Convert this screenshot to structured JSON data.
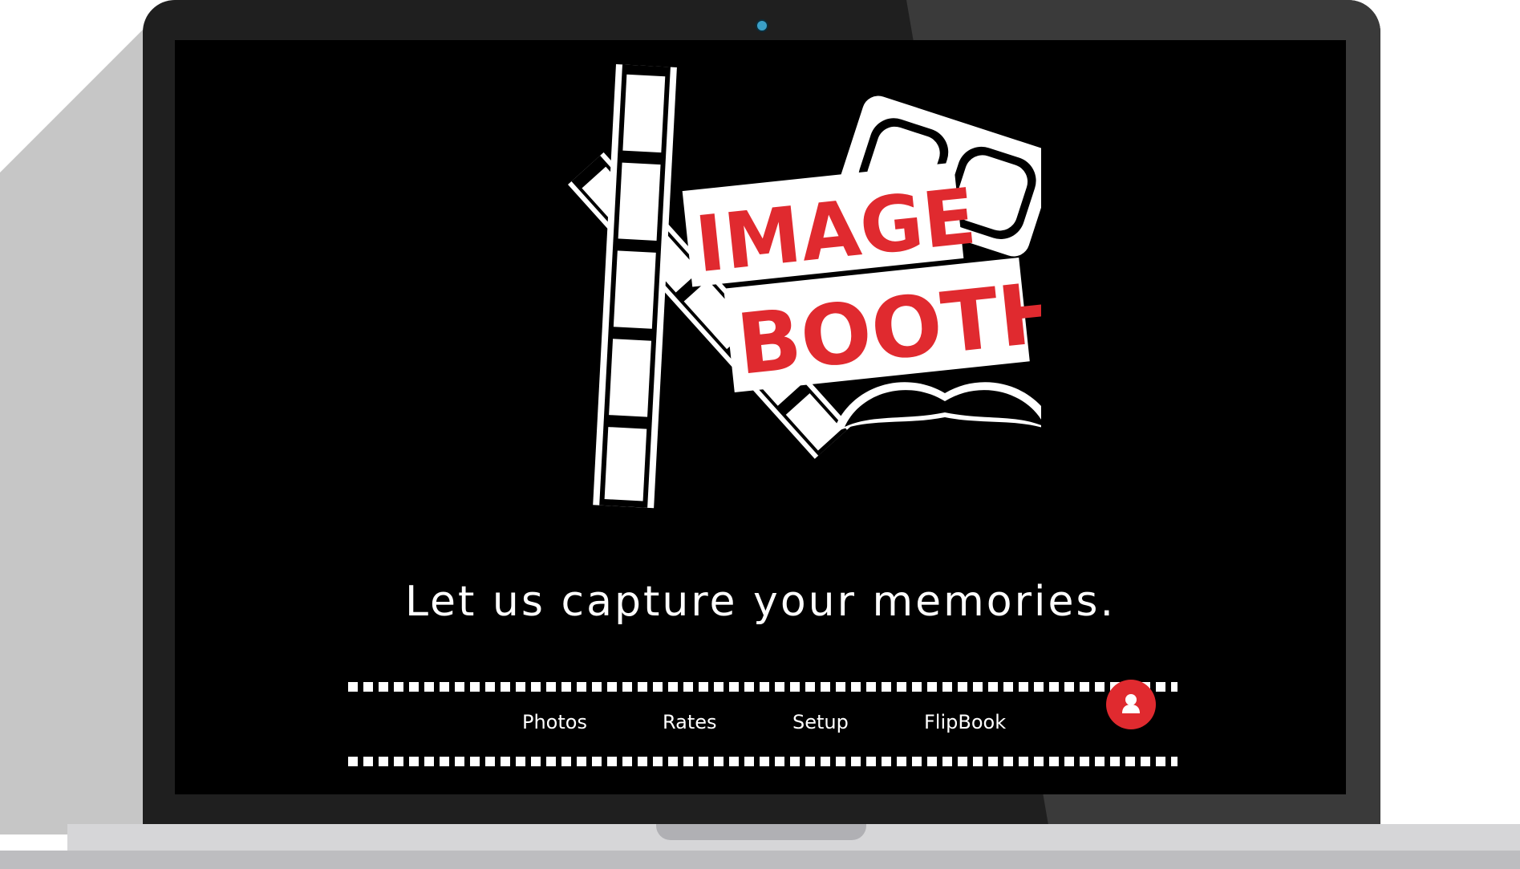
{
  "logo": {
    "line1": "IMAGE",
    "line2": "BOOTH"
  },
  "tagline": "Let us capture your memories.",
  "nav": {
    "items": [
      {
        "label": "Photos"
      },
      {
        "label": "Rates"
      },
      {
        "label": "Setup"
      },
      {
        "label": "FlipBook"
      }
    ]
  },
  "fab": {
    "icon": "user-icon"
  },
  "colors": {
    "background": "#000000",
    "accent": "#e02a2f",
    "text": "#ffffff"
  }
}
